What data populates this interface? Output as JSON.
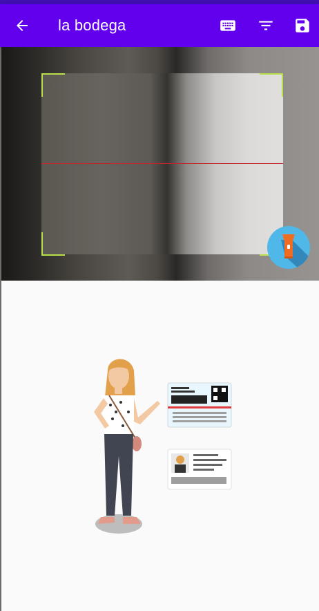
{
  "appbar": {
    "title": "la bodega",
    "icons": {
      "back": "arrow-back-icon",
      "keyboard": "keyboard-icon",
      "filter": "filter-list-icon",
      "save": "save-icon"
    }
  },
  "scanner": {
    "flashlight_icon": "flashlight-icon"
  },
  "colors": {
    "appbar": "#6200ee",
    "statusbar": "#3f0fb0",
    "frame_corners": "#b7e04a",
    "laser": "#c0272d",
    "torch_button": "#4fb8e9",
    "background": "#fafafa"
  }
}
